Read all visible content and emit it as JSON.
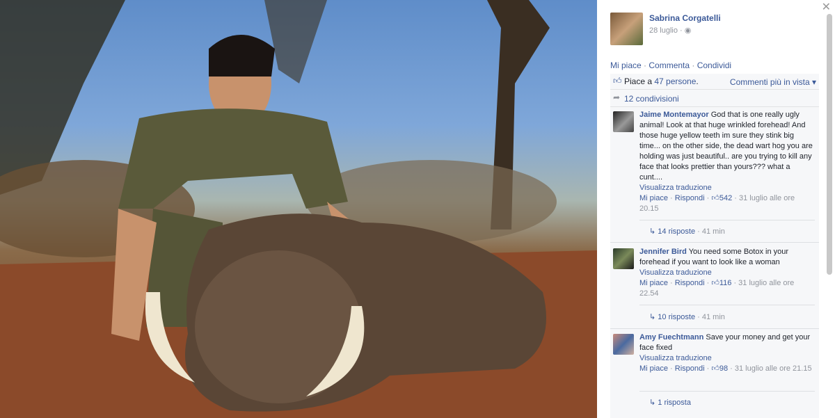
{
  "post": {
    "author": "Sabrina Corgatelli",
    "date": "28 luglio",
    "privacy_icon": "globe-icon"
  },
  "actions": {
    "like": "Mi piace",
    "comment": "Commenta",
    "share": "Condividi"
  },
  "likes": {
    "prefix": "Piace a ",
    "count": "47 persone",
    "suffix": "."
  },
  "sort_label": "Commenti più in vista",
  "shares": "12 condivisioni",
  "comments": [
    {
      "author": "Jaime Montemayor",
      "text": "God that is one really ugly animal! Look at that huge wrinkled forehead! And those huge yellow teeth im sure they stink big time... on the other side, the dead wart hog you are holding was just beautiful.. are you trying to kill any face that looks prettier than yours??? what a cunt....",
      "translate": "Visualizza traduzione",
      "like": "Mi piace",
      "reply": "Rispondi",
      "likes": "542",
      "time": "31 luglio alle ore 20.15",
      "replies": "14 risposte",
      "replies_time": "41 min"
    },
    {
      "author": "Jennifer Bird",
      "text": "You need some Botox in your forehead if you want to look like a woman",
      "translate": "Visualizza traduzione",
      "like": "Mi piace",
      "reply": "Rispondi",
      "likes": "116",
      "time": "31 luglio alle ore 22.54",
      "replies": "10 risposte",
      "replies_time": "41 min"
    },
    {
      "author": "Amy Fuechtmann",
      "text": "Save your money and get your face fixed",
      "translate": "Visualizza traduzione",
      "like": "Mi piace",
      "reply": "Rispondi",
      "likes": "98",
      "time": "31 luglio alle ore 21.15",
      "replies": "1 risposta",
      "replies_time": ""
    }
  ],
  "colors": {
    "link": "#3b5998",
    "meta": "#90949c",
    "panel_bg": "#f6f7f9"
  }
}
